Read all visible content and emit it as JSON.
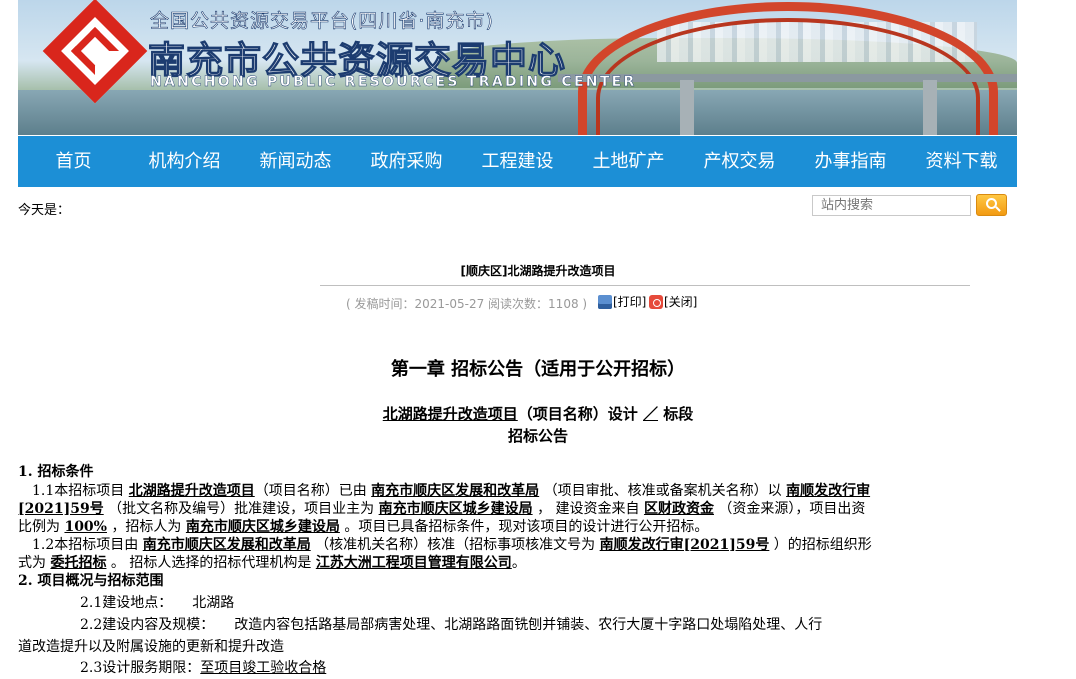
{
  "header": {
    "platform_title": "全国公共资源交易平台(四川省·南充市)",
    "center_name": "南充市公共资源交易中心",
    "center_name_en": "NANCHONG PUBLIC RESOURCES TRADING CENTER",
    "brand_color": "#d9261c"
  },
  "nav": {
    "color": "#1c8fd6",
    "items": [
      "首页",
      "机构介绍",
      "新闻动态",
      "政府采购",
      "工程建设",
      "土地矿产",
      "产权交易",
      "办事指南",
      "资料下载"
    ]
  },
  "toolbar": {
    "date_label": "今天是：",
    "search_placeholder": "站内搜索"
  },
  "article": {
    "title": "[顺庆区]北湖路提升改造项目",
    "meta": "( 发稿时间：2021-05-27  阅读次数：1108 )",
    "print_label": "[打印]",
    "close_label": "[关闭]"
  },
  "doc": {
    "chapter": "第一章  招标公告（适用于公开招标）",
    "project_name": "北湖路提升改造项目",
    "project_suffix": "（项目名称）设计",
    "section_mark": "／",
    "section_suffix": "标段",
    "subtitle": "招标公告",
    "s1_heading": "1. 招标条件",
    "s1_1": {
      "prefix": "1.1本招标项目",
      "project": "北湖路提升改造项目",
      "t1": "（项目名称）已由",
      "approver": "南充市顺庆区发展和改革局",
      "t2": "（项目审批、核准或备案机关名称）以",
      "doc_no_a": "南顺发改行审",
      "doc_no_b": "[2021]59号",
      "t3": "（批文名称及编号）批准建设，项目业主为",
      "owner": "南充市顺庆区城乡建设局",
      "t4": "，  建设资金来自",
      "fund": "区财政资金",
      "t5": "（资金来源），项目出资",
      "t6": "比例为",
      "ratio": "100%",
      "t7": "，招标人为",
      "tenderer": "南充市顺庆区城乡建设局",
      "t8": "。项目已具备招标条件，现对该项目的设计进行公开招标。"
    },
    "s1_2": {
      "prefix": "1.2本招标项目由",
      "approver": "南充市顺庆区发展和改革局",
      "t1": "（核准机关名称）核准（招标事项核准文号为",
      "doc_no": "南顺发改行审[2021]59号",
      "t2": "）的招标组织形",
      "t3": "式为",
      "form": "委托招标",
      "t4": "。  招标人选择的招标代理机构是",
      "agent": "江苏大洲工程项目管理有限公司",
      "t5": "。"
    },
    "s2_heading": "2. 项目概况与招标范围",
    "s2_1_label": "2.1建设地点：",
    "s2_1_value": "北湖路",
    "s2_2_label": "2.2建设内容及规模：",
    "s2_2_value": "改造内容包括路基局部病害处理、北湖路路面铣刨并铺装、农行大厦十字路口处塌陷处理、人行",
    "s2_2_cont": "道改造提升以及附属设施的更新和提升改造",
    "s2_3_label": "2.3设计服务期限：",
    "s2_3_value": "至项目竣工验收合格"
  }
}
